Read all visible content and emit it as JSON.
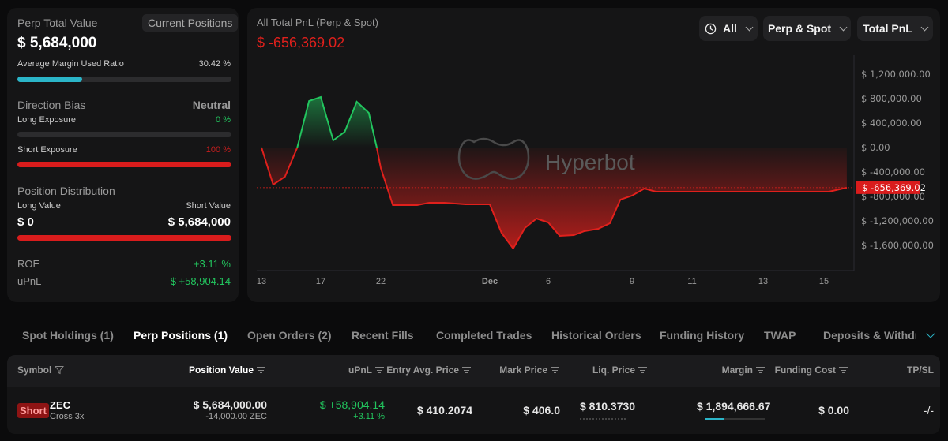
{
  "summary": {
    "title": "Perp Total Value",
    "current_positions_label": "Current Positions",
    "total_value": "$ 5,684,000",
    "margin_label": "Average Margin Used Ratio",
    "margin_value": "30.42 %",
    "margin_ratio": 0.3042,
    "direction_label": "Direction Bias",
    "direction_value": "Neutral",
    "long_exposure_label": "Long Exposure",
    "long_exposure_value": "0 %",
    "long_exposure": 0,
    "short_exposure_label": "Short Exposure",
    "short_exposure_value": "100 %",
    "short_exposure": 1,
    "distribution_label": "Position Distribution",
    "long_value_label": "Long Value",
    "short_value_label": "Short Value",
    "long_value": "$ 0",
    "short_value": "$ 5,684,000",
    "short_share": 1,
    "roe_label": "ROE",
    "roe_value": "+3.11 %",
    "upnl_label": "uPnL",
    "upnl_value": "$ +58,904.14"
  },
  "chart_panel": {
    "title": "All Total PnL (Perp & Spot)",
    "current_value": "$ -656,369.02",
    "filters": [
      {
        "label": "All",
        "icon": "clock-icon"
      },
      {
        "label": "Perp & Spot"
      },
      {
        "label": "Total PnL"
      }
    ],
    "watermark": "Hyperbot"
  },
  "chart_data": {
    "type": "area",
    "title": "All Total PnL (Perp & Spot)",
    "y_ticks": [
      "$ 1,200,000.00",
      "$ 800,000.00",
      "$ 400,000.00",
      "$ 0.00",
      "$ -400,000.00",
      "$ -800,000.00",
      "$ -1,200,000.00",
      "$ -1,600,000.00"
    ],
    "y_tick_values": [
      1200000,
      800000,
      400000,
      0,
      -400000,
      -800000,
      -1200000,
      -1600000
    ],
    "ylim": [
      -1800000,
      1500000
    ],
    "x_ticks": [
      "13",
      "17",
      "22",
      "Dec",
      "6",
      "9",
      "11",
      "13",
      "15"
    ],
    "x_tick_dates": [
      "11-13",
      "11-17",
      "11-22",
      "12-01",
      "12-06",
      "12-09",
      "12-11",
      "12-13",
      "12-15"
    ],
    "last_value_label": "$ -656,369.02",
    "last_value": -656369.02,
    "colors": {
      "positive": "#22c55e",
      "negative": "#e0201c"
    },
    "points": [
      [
        "11-13 00",
        0
      ],
      [
        "11-13 19",
        -606000
      ],
      [
        "11-14 14",
        -477000
      ],
      [
        "11-15 10",
        0
      ],
      [
        "11-16 05",
        761000
      ],
      [
        "11-17 00",
        826000
      ],
      [
        "11-18 01",
        116000
      ],
      [
        "11-19 00",
        258000
      ],
      [
        "11-20 00",
        748000
      ],
      [
        "11-21 00",
        568000
      ],
      [
        "11-21 16",
        0
      ],
      [
        "11-22 00",
        -335000
      ],
      [
        "11-23 00",
        -942000
      ],
      [
        "11-25 00",
        -942000
      ],
      [
        "11-26 00",
        -903000
      ],
      [
        "11-27 06",
        -903000
      ],
      [
        "11-29 00",
        -929000
      ],
      [
        "12-01 00",
        -929000
      ],
      [
        "12-02 00",
        -1394000
      ],
      [
        "12-03 00",
        -1652000
      ],
      [
        "12-04 00",
        -1316000
      ],
      [
        "12-05 00",
        -1161000
      ],
      [
        "12-06 00",
        -1226000
      ],
      [
        "12-06 10",
        -1445000
      ],
      [
        "12-06 22",
        -1432000
      ],
      [
        "12-07 07",
        -1368000
      ],
      [
        "12-07 19",
        -1329000
      ],
      [
        "12-08 05",
        -1239000
      ],
      [
        "12-08 14",
        -852000
      ],
      [
        "12-09 00",
        -787000
      ],
      [
        "12-09 10",
        -671000
      ],
      [
        "12-09 19",
        -723000
      ],
      [
        "12-15 04",
        -723000
      ],
      [
        "12-15 18",
        -656369.02
      ]
    ]
  },
  "tabs": [
    {
      "label": "Spot Holdings (1)"
    },
    {
      "label": "Perp Positions (1)",
      "active": true
    },
    {
      "label": "Open Orders (2)"
    },
    {
      "label": "Recent Fills"
    },
    {
      "label": "Completed Trades"
    },
    {
      "label": "Historical Orders"
    },
    {
      "label": "Funding History"
    },
    {
      "label": "TWAP"
    },
    {
      "label": "Deposits & Withdraw"
    }
  ],
  "table": {
    "headers": [
      "Symbol",
      "Position Value",
      "uPnL",
      "Entry Avg. Price",
      "Mark Price",
      "Liq. Price",
      "Margin",
      "Funding Cost",
      "TP/SL"
    ],
    "rows": [
      {
        "side": "Short",
        "symbol": "ZEC",
        "mode": "Cross 3x",
        "position_value": "$ 5,684,000.00",
        "size": "-14,000.00 ZEC",
        "upnl": "$ +58,904.14",
        "upnl_pct": "+3.11 %",
        "entry": "$ 410.2074",
        "mark": "$ 406.0",
        "liq": "$ 810.3730",
        "margin": "$ 1,894,666.67",
        "margin_ratio": 0.3042,
        "funding": "$ 0.00",
        "tpsl": "-/-"
      }
    ]
  }
}
